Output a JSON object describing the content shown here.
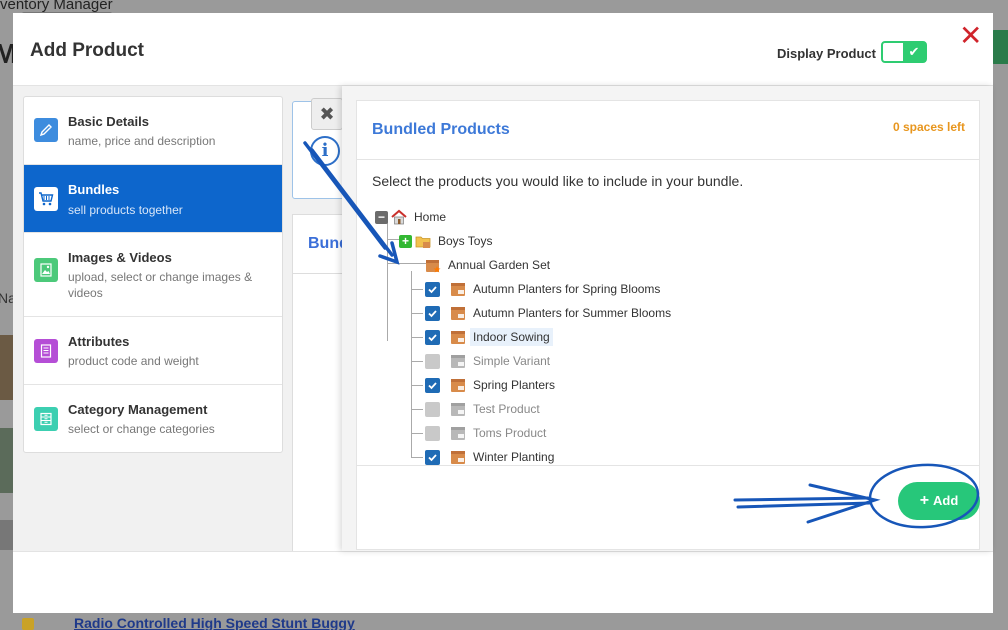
{
  "background": {
    "app_title": "ventory Manager",
    "bottom_link": "Radio Controlled High Speed Stunt Buggy",
    "left_letter": "M",
    "left_na": "Na"
  },
  "modal": {
    "title": "Add Product",
    "display_product_label": "Display Product",
    "display_product_on": true
  },
  "nav": {
    "items": [
      {
        "title": "Basic Details",
        "desc": "name, price and description",
        "icon": "pencil-icon",
        "color": "#3d8cde",
        "active": false
      },
      {
        "title": "Bundles",
        "desc": "sell products together",
        "icon": "cart-icon",
        "color": "#0d66cc",
        "active": true
      },
      {
        "title": "Images & Videos",
        "desc": "upload, select or change images & videos",
        "icon": "image-icon",
        "color": "#4cc97a",
        "active": false
      },
      {
        "title": "Attributes",
        "desc": "product code and weight",
        "icon": "document-icon",
        "color": "#b54ed6",
        "active": false
      },
      {
        "title": "Category Management",
        "desc": "select or change categories",
        "icon": "cabinet-icon",
        "color": "#3ccfb1",
        "active": false
      }
    ]
  },
  "middle": {
    "heading": "Bund"
  },
  "bundle": {
    "title": "Bundled Products",
    "spaces_left": "0 spaces left",
    "instruction": "Select the products you would like to include in your bundle.",
    "add_label": "Add",
    "tree": {
      "root": "Home",
      "folder": "Boys Toys",
      "set": "Annual Garden Set",
      "products": [
        {
          "label": "Autumn Planters for Spring Blooms",
          "state": "checked"
        },
        {
          "label": "Autumn Planters for Summer Blooms",
          "state": "checked"
        },
        {
          "label": "Indoor Sowing",
          "state": "checked",
          "highlight": true
        },
        {
          "label": "Simple Variant",
          "state": "disabled"
        },
        {
          "label": "Spring Planters",
          "state": "checked"
        },
        {
          "label": "Test Product",
          "state": "disabled"
        },
        {
          "label": "Toms Product",
          "state": "disabled"
        },
        {
          "label": "Winter Planting",
          "state": "checked"
        }
      ]
    }
  },
  "colors": {
    "accent_blue": "#0d66cc",
    "title_blue": "#3d79d8",
    "success_green": "#27c77a",
    "warning_orange": "#e8961e",
    "close_red": "#d0242b",
    "annotation_blue": "#1756b8"
  }
}
